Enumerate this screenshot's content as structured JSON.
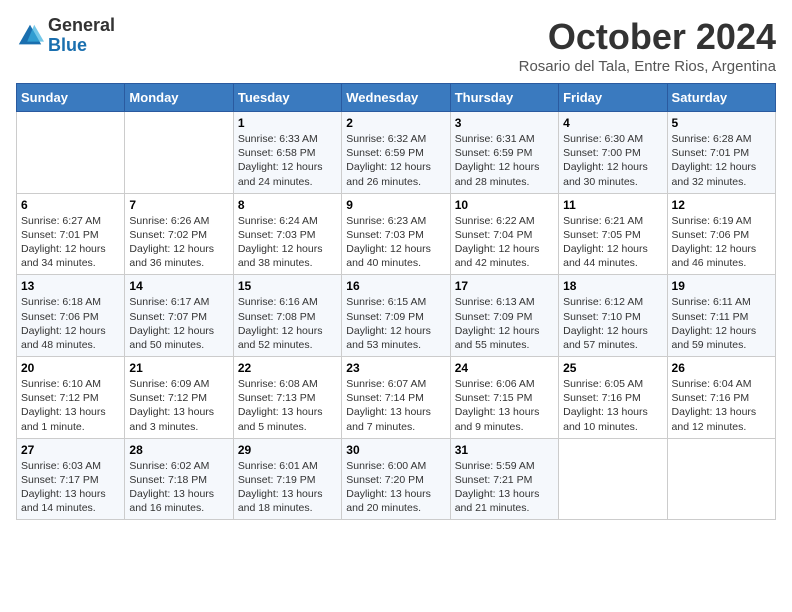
{
  "logo": {
    "general": "General",
    "blue": "Blue"
  },
  "title": "October 2024",
  "subtitle": "Rosario del Tala, Entre Rios, Argentina",
  "headers": [
    "Sunday",
    "Monday",
    "Tuesday",
    "Wednesday",
    "Thursday",
    "Friday",
    "Saturday"
  ],
  "weeks": [
    [
      {
        "num": "",
        "info": ""
      },
      {
        "num": "",
        "info": ""
      },
      {
        "num": "1",
        "info": "Sunrise: 6:33 AM\nSunset: 6:58 PM\nDaylight: 12 hours\nand 24 minutes."
      },
      {
        "num": "2",
        "info": "Sunrise: 6:32 AM\nSunset: 6:59 PM\nDaylight: 12 hours\nand 26 minutes."
      },
      {
        "num": "3",
        "info": "Sunrise: 6:31 AM\nSunset: 6:59 PM\nDaylight: 12 hours\nand 28 minutes."
      },
      {
        "num": "4",
        "info": "Sunrise: 6:30 AM\nSunset: 7:00 PM\nDaylight: 12 hours\nand 30 minutes."
      },
      {
        "num": "5",
        "info": "Sunrise: 6:28 AM\nSunset: 7:01 PM\nDaylight: 12 hours\nand 32 minutes."
      }
    ],
    [
      {
        "num": "6",
        "info": "Sunrise: 6:27 AM\nSunset: 7:01 PM\nDaylight: 12 hours\nand 34 minutes."
      },
      {
        "num": "7",
        "info": "Sunrise: 6:26 AM\nSunset: 7:02 PM\nDaylight: 12 hours\nand 36 minutes."
      },
      {
        "num": "8",
        "info": "Sunrise: 6:24 AM\nSunset: 7:03 PM\nDaylight: 12 hours\nand 38 minutes."
      },
      {
        "num": "9",
        "info": "Sunrise: 6:23 AM\nSunset: 7:03 PM\nDaylight: 12 hours\nand 40 minutes."
      },
      {
        "num": "10",
        "info": "Sunrise: 6:22 AM\nSunset: 7:04 PM\nDaylight: 12 hours\nand 42 minutes."
      },
      {
        "num": "11",
        "info": "Sunrise: 6:21 AM\nSunset: 7:05 PM\nDaylight: 12 hours\nand 44 minutes."
      },
      {
        "num": "12",
        "info": "Sunrise: 6:19 AM\nSunset: 7:06 PM\nDaylight: 12 hours\nand 46 minutes."
      }
    ],
    [
      {
        "num": "13",
        "info": "Sunrise: 6:18 AM\nSunset: 7:06 PM\nDaylight: 12 hours\nand 48 minutes."
      },
      {
        "num": "14",
        "info": "Sunrise: 6:17 AM\nSunset: 7:07 PM\nDaylight: 12 hours\nand 50 minutes."
      },
      {
        "num": "15",
        "info": "Sunrise: 6:16 AM\nSunset: 7:08 PM\nDaylight: 12 hours\nand 52 minutes."
      },
      {
        "num": "16",
        "info": "Sunrise: 6:15 AM\nSunset: 7:09 PM\nDaylight: 12 hours\nand 53 minutes."
      },
      {
        "num": "17",
        "info": "Sunrise: 6:13 AM\nSunset: 7:09 PM\nDaylight: 12 hours\nand 55 minutes."
      },
      {
        "num": "18",
        "info": "Sunrise: 6:12 AM\nSunset: 7:10 PM\nDaylight: 12 hours\nand 57 minutes."
      },
      {
        "num": "19",
        "info": "Sunrise: 6:11 AM\nSunset: 7:11 PM\nDaylight: 12 hours\nand 59 minutes."
      }
    ],
    [
      {
        "num": "20",
        "info": "Sunrise: 6:10 AM\nSunset: 7:12 PM\nDaylight: 13 hours\nand 1 minute."
      },
      {
        "num": "21",
        "info": "Sunrise: 6:09 AM\nSunset: 7:12 PM\nDaylight: 13 hours\nand 3 minutes."
      },
      {
        "num": "22",
        "info": "Sunrise: 6:08 AM\nSunset: 7:13 PM\nDaylight: 13 hours\nand 5 minutes."
      },
      {
        "num": "23",
        "info": "Sunrise: 6:07 AM\nSunset: 7:14 PM\nDaylight: 13 hours\nand 7 minutes."
      },
      {
        "num": "24",
        "info": "Sunrise: 6:06 AM\nSunset: 7:15 PM\nDaylight: 13 hours\nand 9 minutes."
      },
      {
        "num": "25",
        "info": "Sunrise: 6:05 AM\nSunset: 7:16 PM\nDaylight: 13 hours\nand 10 minutes."
      },
      {
        "num": "26",
        "info": "Sunrise: 6:04 AM\nSunset: 7:16 PM\nDaylight: 13 hours\nand 12 minutes."
      }
    ],
    [
      {
        "num": "27",
        "info": "Sunrise: 6:03 AM\nSunset: 7:17 PM\nDaylight: 13 hours\nand 14 minutes."
      },
      {
        "num": "28",
        "info": "Sunrise: 6:02 AM\nSunset: 7:18 PM\nDaylight: 13 hours\nand 16 minutes."
      },
      {
        "num": "29",
        "info": "Sunrise: 6:01 AM\nSunset: 7:19 PM\nDaylight: 13 hours\nand 18 minutes."
      },
      {
        "num": "30",
        "info": "Sunrise: 6:00 AM\nSunset: 7:20 PM\nDaylight: 13 hours\nand 20 minutes."
      },
      {
        "num": "31",
        "info": "Sunrise: 5:59 AM\nSunset: 7:21 PM\nDaylight: 13 hours\nand 21 minutes."
      },
      {
        "num": "",
        "info": ""
      },
      {
        "num": "",
        "info": ""
      }
    ]
  ]
}
